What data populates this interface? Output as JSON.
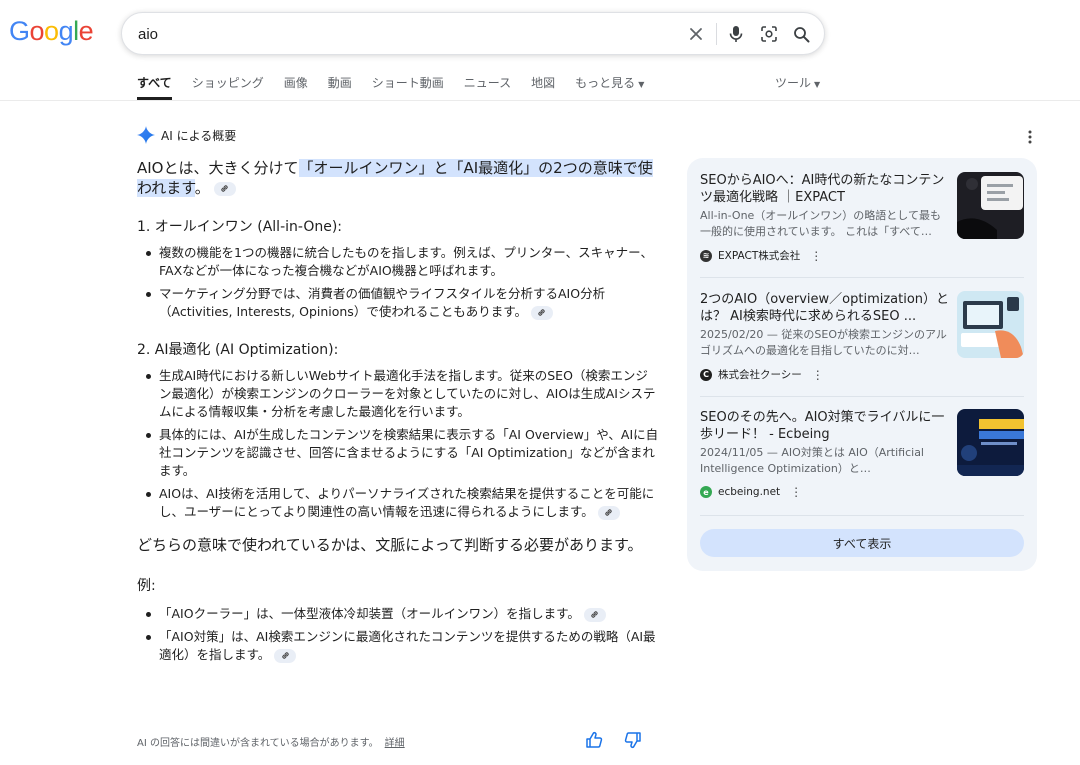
{
  "logo": {
    "letters": [
      "G",
      "o",
      "o",
      "g",
      "l",
      "e"
    ],
    "colors": [
      "#4285F4",
      "#EA4335",
      "#FBBC05",
      "#4285F4",
      "#34A853",
      "#EA4335"
    ]
  },
  "search": {
    "query": "aio"
  },
  "tabs": [
    {
      "label": "すべて",
      "active": true
    },
    {
      "label": "ショッピング"
    },
    {
      "label": "画像"
    },
    {
      "label": "動画"
    },
    {
      "label": "ショート動画"
    },
    {
      "label": "ニュース"
    },
    {
      "label": "地図"
    },
    {
      "label": "もっと見る",
      "caret": true
    }
  ],
  "tools_label": "ツール",
  "ai_overview": {
    "header": "AI による概要",
    "lead_plain": "AIOとは、大きく分けて",
    "lead_highlight": "「オールインワン」と「AI最適化」の2つの意味で使われます",
    "lead_end": "。",
    "section1_title": "1. オールインワン (All-in-One):",
    "section1_points": [
      "複数の機能を1つの機器に統合したものを指します。例えば、プリンター、スキャナー、FAXなどが一体になった複合機などがAIO機器と呼ばれます。",
      "マーケティング分野では、消費者の価値観やライフスタイルを分析するAIO分析（Activities, Interests, Opinions）で使われることもあります。"
    ],
    "section2_title": "2. AI最適化 (AI Optimization):",
    "section2_points": [
      "生成AI時代における新しいWebサイト最適化手法を指します。従来のSEO（検索エンジン最適化）が検索エンジンのクローラーを対象としていたのに対し、AIOは生成AIシステムによる情報収集・分析を考慮した最適化を行います。",
      "具体的には、AIが生成したコンテンツを検索結果に表示する「AI Overview」や、AIに自社コンテンツを認識させ、回答に含ませるようにする「AI Optimization」などが含まれます。",
      "AIOは、AI技術を活用して、よりパーソナライズされた検索結果を提供することを可能にし、ユーザーにとってより関連性の高い情報を迅速に得られるようにします。"
    ],
    "conclusion": "どちらの意味で使われているかは、文脈によって判断する必要があります。",
    "example_title": "例:",
    "examples": [
      "「AIOクーラー」は、一体型液体冷却装置（オールインワン）を指します。",
      "「AIO対策」は、AI検索エンジンに最適化されたコンテンツを提供するための戦略（AI最適化）を指します。"
    ],
    "disclaimer": "AI の回答には間違いが含まれている場合があります。",
    "details_link": "詳細"
  },
  "sources": [
    {
      "title": "SEOからAIOへ：AI時代の新たなコンテンツ最適化戦略 ｜EXPACT",
      "snippet": "All-in-One（オールインワン）の略語として最も一般的に使用されています。 これは「すべて…",
      "source": "EXPACT株式会社",
      "fav_color": "#333333",
      "fav_icon": "wave-icon"
    },
    {
      "title": "2つのAIO（overview／optimization）とは？ AI検索時代に求められるSEO ...",
      "snippet": "2025/02/20 — 従来のSEOが検索エンジンのアルゴリズムへの最適化を目指していたのに対…",
      "source": "株式会社クーシー",
      "fav_color": "#1f1f1f",
      "fav_icon": "c-icon"
    },
    {
      "title": "SEOのその先へ。AIO対策でライバルに一歩リード！ - Ecbeing",
      "snippet": "2024/11/05 — AIO対策とは AIO（Artificial Intelligence Optimization）と…",
      "source": "ecbeing.net",
      "fav_color": "#34A853",
      "fav_icon": "leaf-icon"
    }
  ],
  "show_all_label": "すべて表示"
}
